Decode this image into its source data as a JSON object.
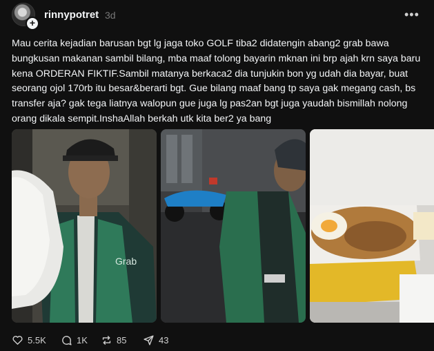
{
  "post": {
    "username": "rinnypotret",
    "time": "3d",
    "more_label": "•••",
    "text": "Mau cerita kejadian barusan bgt lg jaga toko GOLF tiba2 didatengin abang2 grab bawa bungkusan makanan sambil bilang, mba maaf tolong bayarin mknan ini brp ajah krn saya baru kena ORDERAN FIKTIF.Sambil matanya berkaca2 dia tunjukin bon yg udah dia bayar, buat seorang ojol 170rb itu besar&berarti bgt. Gue bilang maaf bang tp saya gak megang cash, bs transfer aja? gak tega liatnya walopun gue juga lg pas2an bgt juga yaudah bismillah nolong orang dikala sempit.InshaAllah berkah utk kita ber2 ya bang",
    "photo_text": "Grab"
  },
  "actions": {
    "likes": "5.5K",
    "replies": "1K",
    "reposts": "85",
    "shares": "43"
  },
  "colors": {
    "background": "#101010",
    "text": "#f3f5f7",
    "muted": "#777777",
    "grab_green": "#3aa66a"
  }
}
